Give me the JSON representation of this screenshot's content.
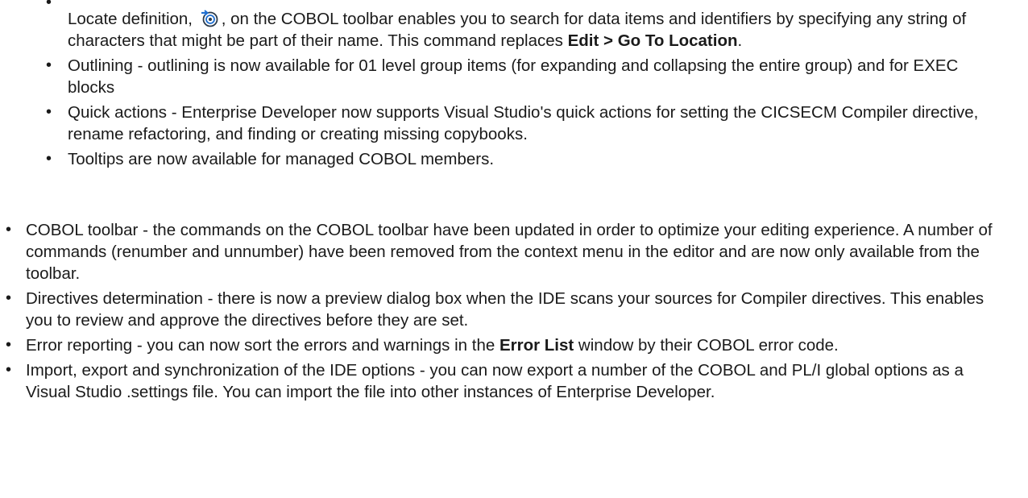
{
  "sub_items": [
    {
      "before": "Locate definition, ",
      "icon": "locate-definition-icon",
      "after": ", on the COBOL toolbar enables you to search for data items and identifiers by specifying any string of characters that might be part of their name. This command replaces ",
      "bold": "Edit > Go To Location",
      "end": "."
    },
    {
      "text": "Outlining - outlining is now available for 01 level group items (for expanding and collapsing the entire group) and for EXEC blocks"
    },
    {
      "text": "Quick actions - Enterprise Developer now supports Visual Studio's quick actions for setting the CICSECM Compiler directive, rename refactoring, and finding or creating missing copybooks."
    },
    {
      "text": "Tooltips are now available for managed COBOL members."
    }
  ],
  "top_items": [
    {
      "text": "COBOL toolbar - the commands on the COBOL toolbar have been updated in order to optimize your editing experience. A number of commands (renumber and unnumber) have been removed from the context menu in the editor and are now only available from the toolbar."
    },
    {
      "text": "Directives determination - there is now a preview dialog box when the IDE scans your sources for Compiler directives. This enables you to review and approve the directives before they are set."
    },
    {
      "before": "Error reporting - you can now sort the errors and warnings in the ",
      "bold": "Error List",
      "after": " window by their COBOL error code."
    },
    {
      "text": "Import, export and synchronization of the IDE options - you can now export a number of the COBOL and PL/I global options as a Visual Studio .settings file. You can import the file into other instances of Enterprise Developer."
    }
  ],
  "bullet_char": "•",
  "colors": {
    "text": "#1a1a1a",
    "icon_blue": "#1f6fd1",
    "icon_dark": "#2b3a4a"
  }
}
